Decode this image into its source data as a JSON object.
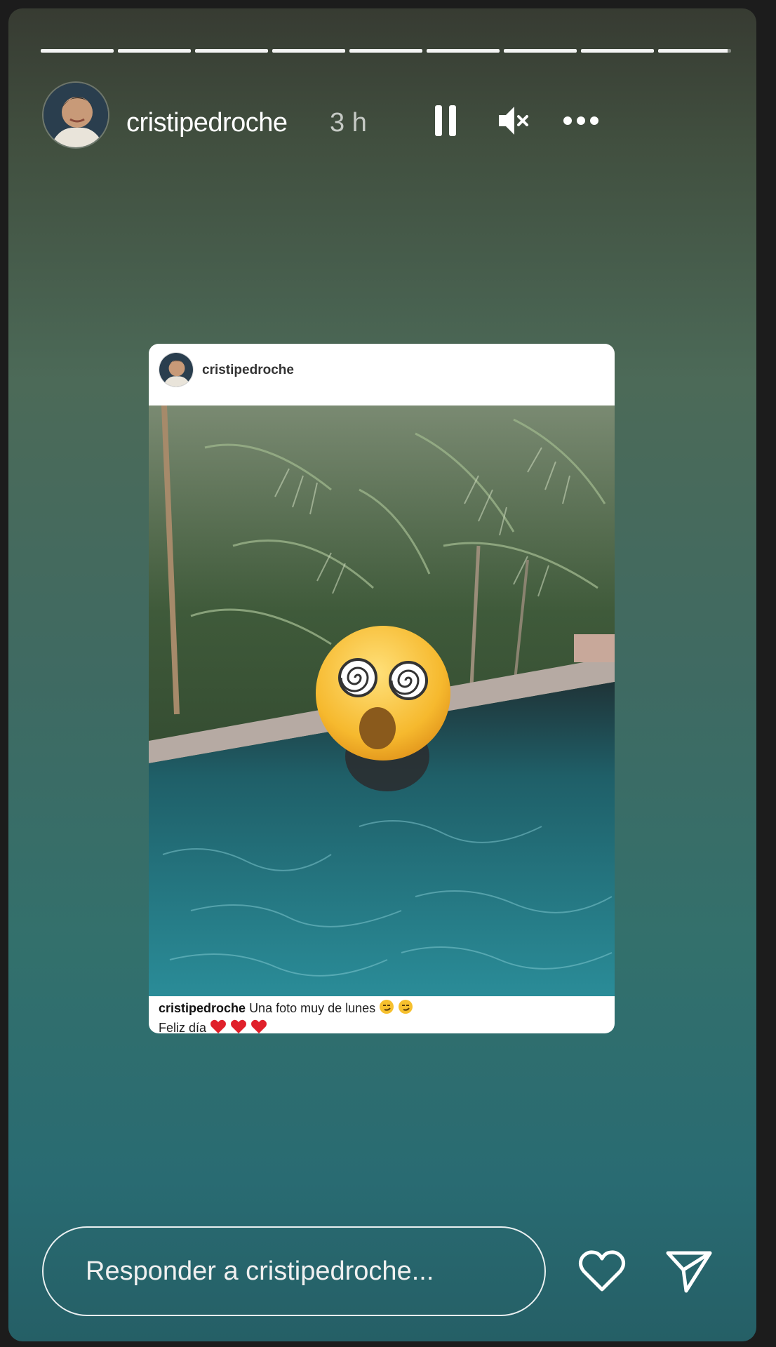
{
  "story": {
    "progress_segments": [
      1,
      1,
      1,
      1,
      1,
      1,
      1,
      1,
      0.95
    ],
    "header": {
      "username": "cristipedroche",
      "time": "3 h"
    },
    "controls": {
      "pause": "pause-icon",
      "mute": "muted-speaker-icon",
      "more": "more-icon"
    }
  },
  "post_card": {
    "username": "cristipedroche",
    "caption_username": "cristipedroche",
    "caption_text": "Una foto muy de lunes",
    "caption_line2": "Feliz día"
  },
  "reply": {
    "placeholder": "Responder a cristipedroche..."
  },
  "colors": {
    "accent_heart": "#e0202a",
    "text_primary": "#ffffff"
  }
}
